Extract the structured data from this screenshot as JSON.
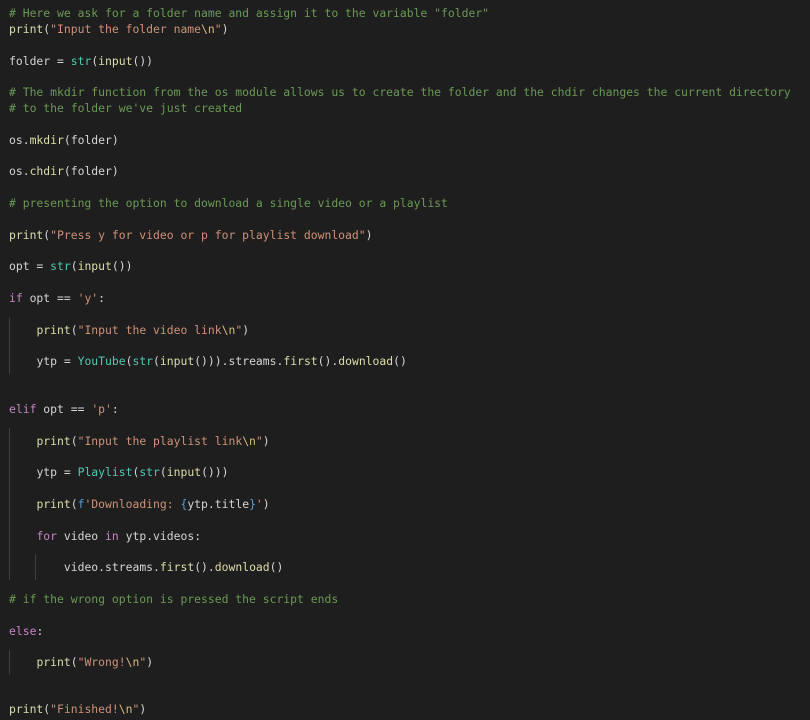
{
  "editor": {
    "theme_colors": {
      "background": "#1e1e1e",
      "comment": "#6a9955",
      "string": "#ce9178",
      "keyword": "#c586c0",
      "builtin": "#4ec9b0",
      "function": "#dcdcaa",
      "default": "#d4d4d4",
      "escape": "#d7ba7d"
    },
    "lines": [
      [
        {
          "t": "# Here we ask for a folder name and assign it to the variable \"folder\"",
          "c": "comment"
        }
      ],
      [
        {
          "t": "print",
          "c": "func"
        },
        {
          "t": "(",
          "c": "punct"
        },
        {
          "t": "\"Input the folder name",
          "c": "string"
        },
        {
          "t": "\\n",
          "c": "escape"
        },
        {
          "t": "\"",
          "c": "string"
        },
        {
          "t": ")",
          "c": "punct"
        }
      ],
      [
        {
          "t": "folder",
          "c": "var"
        },
        {
          "t": " = ",
          "c": "op"
        },
        {
          "t": "str",
          "c": "builtin"
        },
        {
          "t": "(",
          "c": "punct"
        },
        {
          "t": "input",
          "c": "func"
        },
        {
          "t": "())",
          "c": "punct"
        }
      ],
      [
        {
          "t": "# The mkdir function from the os module allows us to create the folder and the chdir changes the current directory",
          "c": "comment"
        }
      ],
      [
        {
          "t": "# to the folder we've just created",
          "c": "comment"
        }
      ],
      [
        {
          "t": "os",
          "c": "var"
        },
        {
          "t": ".",
          "c": "punct"
        },
        {
          "t": "mkdir",
          "c": "func"
        },
        {
          "t": "(",
          "c": "punct"
        },
        {
          "t": "folder",
          "c": "var"
        },
        {
          "t": ")",
          "c": "punct"
        }
      ],
      [
        {
          "t": "os",
          "c": "var"
        },
        {
          "t": ".",
          "c": "punct"
        },
        {
          "t": "chdir",
          "c": "func"
        },
        {
          "t": "(",
          "c": "punct"
        },
        {
          "t": "folder",
          "c": "var"
        },
        {
          "t": ")",
          "c": "punct"
        }
      ],
      [
        {
          "t": "# presenting the option to download a single video or a playlist",
          "c": "comment"
        }
      ],
      [
        {
          "t": "print",
          "c": "func"
        },
        {
          "t": "(",
          "c": "punct"
        },
        {
          "t": "\"Press y for video or p for playlist download\"",
          "c": "string"
        },
        {
          "t": ")",
          "c": "punct"
        }
      ],
      [
        {
          "t": "opt",
          "c": "var"
        },
        {
          "t": " = ",
          "c": "op"
        },
        {
          "t": "str",
          "c": "builtin"
        },
        {
          "t": "(",
          "c": "punct"
        },
        {
          "t": "input",
          "c": "func"
        },
        {
          "t": "())",
          "c": "punct"
        }
      ],
      [
        {
          "t": "if",
          "c": "keyword"
        },
        {
          "t": " ",
          "c": "op"
        },
        {
          "t": "opt",
          "c": "var"
        },
        {
          "t": " == ",
          "c": "op"
        },
        {
          "t": "'y'",
          "c": "string"
        },
        {
          "t": ":",
          "c": "punct"
        }
      ],
      [
        {
          "t": "    ",
          "c": "op"
        },
        {
          "t": "print",
          "c": "func"
        },
        {
          "t": "(",
          "c": "punct"
        },
        {
          "t": "\"Input the video link",
          "c": "string"
        },
        {
          "t": "\\n",
          "c": "escape"
        },
        {
          "t": "\"",
          "c": "string"
        },
        {
          "t": ")",
          "c": "punct"
        }
      ],
      [
        {
          "t": "    ",
          "c": "op"
        },
        {
          "t": "ytp",
          "c": "var"
        },
        {
          "t": " = ",
          "c": "op"
        },
        {
          "t": "YouTube",
          "c": "builtin"
        },
        {
          "t": "(",
          "c": "punct"
        },
        {
          "t": "str",
          "c": "builtin"
        },
        {
          "t": "(",
          "c": "punct"
        },
        {
          "t": "input",
          "c": "func"
        },
        {
          "t": "())).",
          "c": "punct"
        },
        {
          "t": "streams",
          "c": "var"
        },
        {
          "t": ".",
          "c": "punct"
        },
        {
          "t": "first",
          "c": "func"
        },
        {
          "t": "().",
          "c": "punct"
        },
        {
          "t": "download",
          "c": "func"
        },
        {
          "t": "()",
          "c": "punct"
        }
      ],
      [
        {
          "t": "elif",
          "c": "keyword"
        },
        {
          "t": " ",
          "c": "op"
        },
        {
          "t": "opt",
          "c": "var"
        },
        {
          "t": " == ",
          "c": "op"
        },
        {
          "t": "'p'",
          "c": "string"
        },
        {
          "t": ":",
          "c": "punct"
        }
      ],
      [
        {
          "t": "    ",
          "c": "op"
        },
        {
          "t": "print",
          "c": "func"
        },
        {
          "t": "(",
          "c": "punct"
        },
        {
          "t": "\"Input the playlist link",
          "c": "string"
        },
        {
          "t": "\\n",
          "c": "escape"
        },
        {
          "t": "\"",
          "c": "string"
        },
        {
          "t": ")",
          "c": "punct"
        }
      ],
      [
        {
          "t": "    ",
          "c": "op"
        },
        {
          "t": "ytp",
          "c": "var"
        },
        {
          "t": " = ",
          "c": "op"
        },
        {
          "t": "Playlist",
          "c": "builtin"
        },
        {
          "t": "(",
          "c": "punct"
        },
        {
          "t": "str",
          "c": "builtin"
        },
        {
          "t": "(",
          "c": "punct"
        },
        {
          "t": "input",
          "c": "func"
        },
        {
          "t": "()))",
          "c": "punct"
        }
      ],
      [
        {
          "t": "    ",
          "c": "op"
        },
        {
          "t": "print",
          "c": "func"
        },
        {
          "t": "(",
          "c": "punct"
        },
        {
          "t": "f",
          "c": "strprefix"
        },
        {
          "t": "'Downloading: ",
          "c": "string"
        },
        {
          "t": "{",
          "c": "fbrace"
        },
        {
          "t": "ytp",
          "c": "var"
        },
        {
          "t": ".",
          "c": "punct"
        },
        {
          "t": "title",
          "c": "var"
        },
        {
          "t": "}",
          "c": "fbrace"
        },
        {
          "t": "'",
          "c": "string"
        },
        {
          "t": ")",
          "c": "punct"
        }
      ],
      [
        {
          "t": "    ",
          "c": "op"
        },
        {
          "t": "for",
          "c": "keyword"
        },
        {
          "t": " ",
          "c": "op"
        },
        {
          "t": "video",
          "c": "var"
        },
        {
          "t": " ",
          "c": "op"
        },
        {
          "t": "in",
          "c": "keyword"
        },
        {
          "t": " ",
          "c": "op"
        },
        {
          "t": "ytp",
          "c": "var"
        },
        {
          "t": ".",
          "c": "punct"
        },
        {
          "t": "videos",
          "c": "var"
        },
        {
          "t": ":",
          "c": "punct"
        }
      ],
      [
        {
          "t": "        ",
          "c": "op"
        },
        {
          "t": "video",
          "c": "var"
        },
        {
          "t": ".",
          "c": "punct"
        },
        {
          "t": "streams",
          "c": "var"
        },
        {
          "t": ".",
          "c": "punct"
        },
        {
          "t": "first",
          "c": "func"
        },
        {
          "t": "().",
          "c": "punct"
        },
        {
          "t": "download",
          "c": "func"
        },
        {
          "t": "()",
          "c": "punct"
        }
      ],
      [
        {
          "t": "# if the wrong option is pressed the script ends",
          "c": "comment"
        }
      ],
      [
        {
          "t": "else",
          "c": "keyword"
        },
        {
          "t": ":",
          "c": "punct"
        }
      ],
      [
        {
          "t": "    ",
          "c": "op"
        },
        {
          "t": "print",
          "c": "func"
        },
        {
          "t": "(",
          "c": "punct"
        },
        {
          "t": "\"Wrong!",
          "c": "string"
        },
        {
          "t": "\\n",
          "c": "escape"
        },
        {
          "t": "\"",
          "c": "string"
        },
        {
          "t": ")",
          "c": "punct"
        }
      ],
      [
        {
          "t": "print",
          "c": "func"
        },
        {
          "t": "(",
          "c": "punct"
        },
        {
          "t": "\"Finished!",
          "c": "string"
        },
        {
          "t": "\\n",
          "c": "escape"
        },
        {
          "t": "\"",
          "c": "string"
        },
        {
          "t": ")",
          "c": "punct"
        }
      ]
    ]
  }
}
